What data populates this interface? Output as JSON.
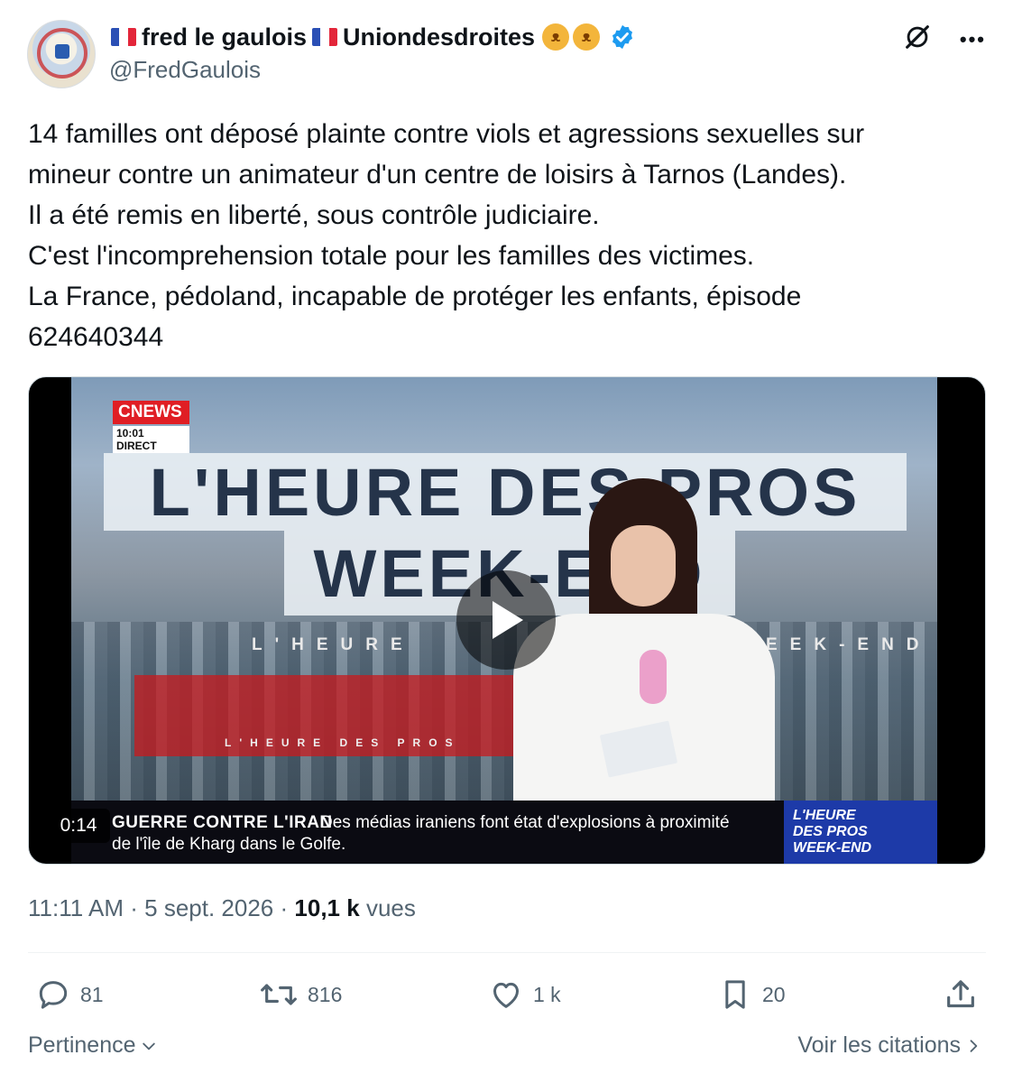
{
  "author": {
    "display_name_part1": "fred le gaulois",
    "display_name_part2": "Uniondesdroites",
    "handle": "@FredGaulois",
    "flag_icon": "french-flag-icon",
    "emoji_icon": "cat-face-icon",
    "verified_icon": "verified-badge-icon",
    "flag_colors": [
      "#2a4fb5",
      "#ffffff",
      "#e3263a"
    ],
    "verified_color": "#1d9bf0"
  },
  "tweet": {
    "lines": [
      "14 familles ont déposé plainte contre viols et agressions sexuelles sur",
      "mineur contre un animateur d'un centre de loisirs à Tarnos (Landes).",
      "Il a été remis en liberté, sous contrôle judiciaire.",
      "C'est l'incomprehension totale pour les familles des victimes.",
      "La France, pédoland, incapable de protéger les enfants, épisode",
      "624640344"
    ]
  },
  "video": {
    "duration": "0:14",
    "channel": "CNEWS",
    "clock": "10:01 DIRECT",
    "show_title_line1": "L'HEURE DES PROS",
    "show_title_line2": "WEEK-END",
    "overlay_left": "L'HEURE",
    "overlay_right": "EEK-END",
    "red_overlay": "L'HEURE DES PROS",
    "ticker_tag": "GUERRE CONTRE L'IRAN",
    "ticker_line1": "Des médias iraniens font état d'explosions à proximité",
    "ticker_line2": "de l'île de Kharg dans le Golfe.",
    "box_line1": "L'HEURE",
    "box_line2": "DES PROS",
    "box_line3": "WEEK-END",
    "play_icon": "play-icon"
  },
  "meta": {
    "time": "11:11 AM",
    "separator": "·",
    "date": "5 sept. 2026",
    "views_count": "10,1 k",
    "views_label": "vues"
  },
  "actions": {
    "replies": "81",
    "reposts": "816",
    "likes": "1 k",
    "bookmarks": "20"
  },
  "footer": {
    "sort_label": "Pertinence",
    "quotes_link": "Voir les citations"
  },
  "colors": {
    "text_primary": "#0f1419",
    "text_secondary": "#536471",
    "accent_blue": "#1d9bf0"
  }
}
